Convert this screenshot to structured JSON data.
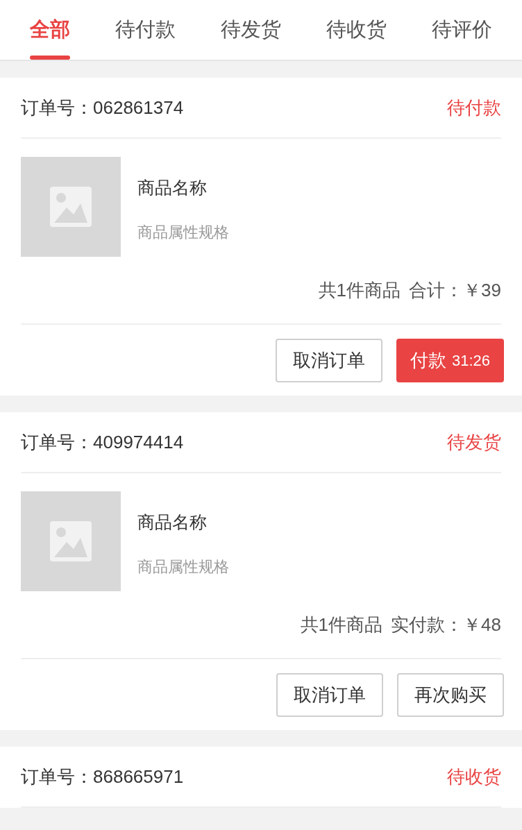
{
  "tabs": [
    {
      "label": "全部",
      "selected": true
    },
    {
      "label": "待付款",
      "selected": false
    },
    {
      "label": "待发货",
      "selected": false
    },
    {
      "label": "待收货",
      "selected": false
    },
    {
      "label": "待评价",
      "selected": false
    }
  ],
  "orders": [
    {
      "order_label": "订单号：",
      "order_no": "062861374",
      "status": "待付款",
      "products": [
        {
          "name": "商品名称",
          "spec": "商品属性规格"
        }
      ],
      "count": "共1件商品",
      "total_label": "合计：",
      "total": "￥39",
      "buttons": [
        {
          "kind": "outline",
          "label": "取消订单"
        },
        {
          "kind": "primary",
          "label": "付款",
          "countdown": "31:26"
        }
      ]
    },
    {
      "order_label": "订单号：",
      "order_no": "409974414",
      "status": "待发货",
      "products": [
        {
          "name": "商品名称",
          "spec": "商品属性规格"
        }
      ],
      "count": "共1件商品",
      "total_label": "实付款：",
      "total": "￥48",
      "buttons": [
        {
          "kind": "outline",
          "label": "取消订单"
        },
        {
          "kind": "outline",
          "label": "再次购买"
        }
      ]
    },
    {
      "order_label": "订单号：",
      "order_no": "868665971",
      "status": "待收货"
    }
  ]
}
